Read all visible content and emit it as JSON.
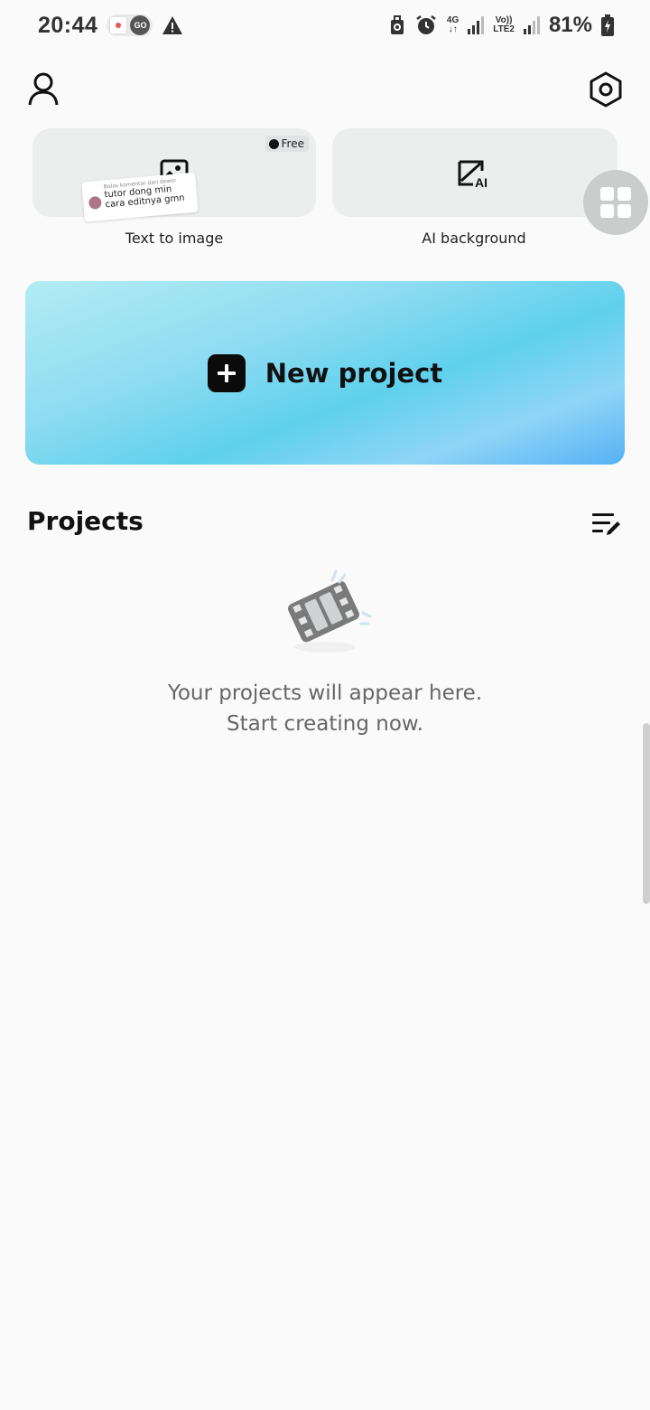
{
  "status_bar": {
    "time": "20:44",
    "go_label": "GO",
    "network_top": "4G",
    "volte_top": "Vo))",
    "volte_bottom": "LTE2",
    "battery_text": "81%"
  },
  "header": {
    "profile_icon": "person-outline-icon",
    "settings_icon": "hexagon-settings-icon"
  },
  "tools": [
    {
      "label": "Text to image",
      "icon": "image-icon",
      "badge": "Free"
    },
    {
      "label": "AI background",
      "icon": "ai-edit-icon"
    }
  ],
  "overlay_comment": {
    "meta": "Balas komentar dari dewin",
    "text": "tutor dong min cara editnya gmn"
  },
  "new_project": {
    "label": "New project",
    "gradient": [
      "#b2ecf3",
      "#5fd1ec",
      "#56b1f5"
    ]
  },
  "projects": {
    "title": "Projects",
    "empty_line1": "Your projects will appear here.",
    "empty_line2": "Start creating now."
  }
}
